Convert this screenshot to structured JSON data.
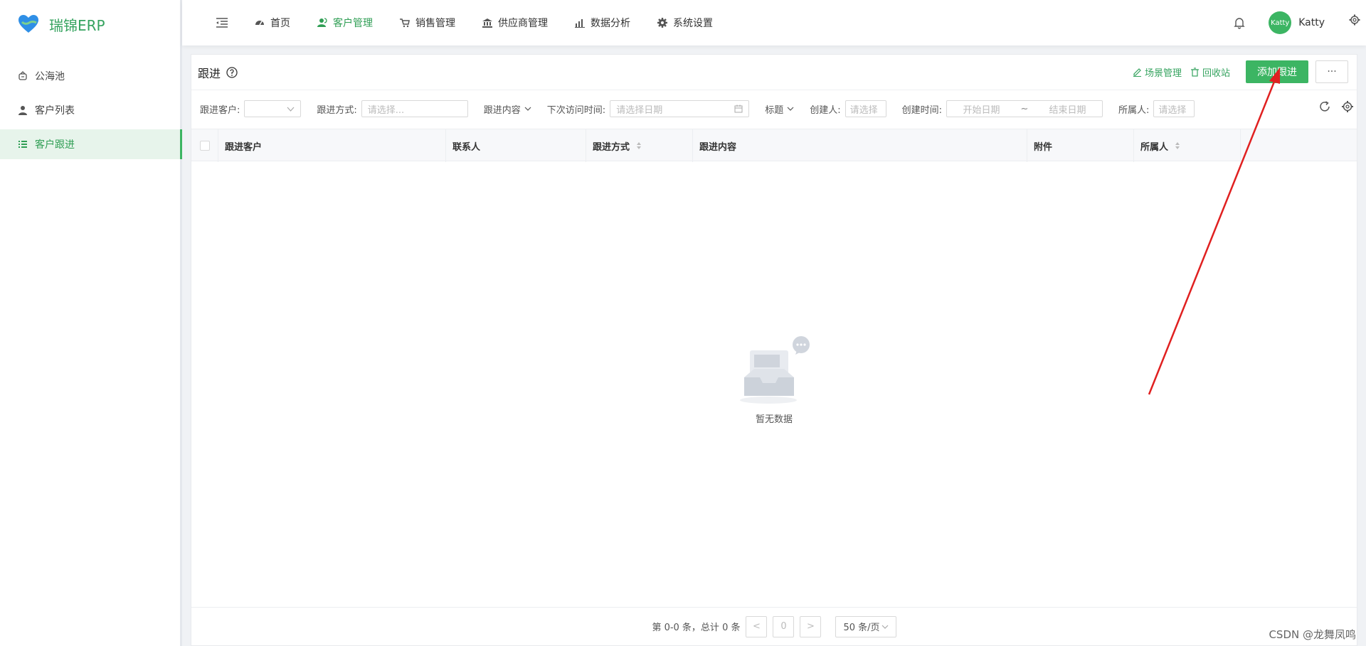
{
  "app": {
    "name": "瑞锦ERP"
  },
  "sidebar": {
    "items": [
      {
        "label": "公海池",
        "icon": "sea-pool-icon",
        "active": false
      },
      {
        "label": "客户列表",
        "icon": "user-icon",
        "active": false
      },
      {
        "label": "客户跟进",
        "icon": "list-icon",
        "active": true
      }
    ]
  },
  "topnav": {
    "items": [
      {
        "label": "首页",
        "icon": "dashboard-icon",
        "active": false
      },
      {
        "label": "客户管理",
        "icon": "customers-icon",
        "active": true
      },
      {
        "label": "销售管理",
        "icon": "cart-icon",
        "active": false
      },
      {
        "label": "供应商管理",
        "icon": "bank-icon",
        "active": false
      },
      {
        "label": "数据分析",
        "icon": "bar-chart-icon",
        "active": false
      },
      {
        "label": "系统设置",
        "icon": "gear-icon",
        "active": false
      }
    ],
    "user": {
      "avatar_text": "Katty",
      "name": "Katty"
    }
  },
  "page": {
    "title": "跟进",
    "scene_label": "场景管理",
    "recycle_label": "回收站",
    "add_label": "添加跟进",
    "more_label": "···"
  },
  "filters": {
    "customer_label": "跟进客户:",
    "method_label": "跟进方式:",
    "method_placeholder": "请选择...",
    "content_label": "跟进内容",
    "next_visit_label": "下次访问时间:",
    "next_visit_placeholder": "请选择日期",
    "title_label": "标题",
    "creator_label": "创建人:",
    "creator_placeholder": "请选择",
    "created_time_label": "创建时间:",
    "start_placeholder": "开始日期",
    "range_sep": "~",
    "end_placeholder": "结束日期",
    "owner_label": "所属人:",
    "owner_placeholder": "请选择"
  },
  "table": {
    "columns": [
      "跟进客户",
      "联系人",
      "跟进方式",
      "跟进内容",
      "附件",
      "所属人"
    ],
    "empty_text": "暂无数据"
  },
  "pager": {
    "summary": "第 0-0 条，总计 0 条",
    "prev": "<",
    "current": "0",
    "next": ">",
    "page_size": "50 条/页"
  },
  "watermark": "CSDN @龙舞凤鸣",
  "colors": {
    "accent": "#3cb563",
    "annotation": "#e02020"
  }
}
